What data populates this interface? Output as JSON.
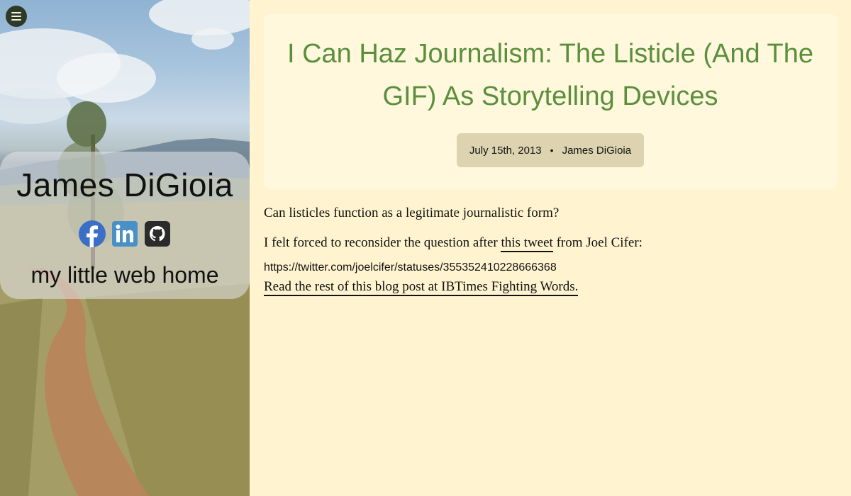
{
  "sidebar": {
    "menu_icon": "hamburger-menu-icon",
    "profile": {
      "name": "James DiGioia",
      "tagline": "my little web home",
      "social": [
        {
          "name": "facebook",
          "icon": "facebook-icon",
          "color": "#3b6fc6"
        },
        {
          "name": "linkedin",
          "icon": "linkedin-icon",
          "color": "#4a90c8"
        },
        {
          "name": "github",
          "icon": "github-icon",
          "color": "#2b2b2b"
        }
      ]
    }
  },
  "post": {
    "title": "I Can Haz Journalism: The Listicle (And The GIF) As Storytelling Devices",
    "date": "July 15th, 2013",
    "separator": "•",
    "author": "James DiGioia",
    "paragraph1": "Can listicles function as a legitimate journalistic form?",
    "paragraph2_before": "I felt forced to reconsider the question after ",
    "paragraph2_link": "this tweet",
    "paragraph2_after": " from Joel Cifer:",
    "embed_url": "https://twitter.com/joelcifer/statuses/355352410228666368",
    "read_more": "Read the rest of this blog post at IBTimes Fighting Words."
  },
  "colors": {
    "page_bg": "#fff4cf",
    "title_card_bg": "#fff8dc",
    "title_color": "#5b8f3e",
    "meta_badge_bg": "#ddd3b1",
    "menu_button_bg": "#2f3a26"
  }
}
